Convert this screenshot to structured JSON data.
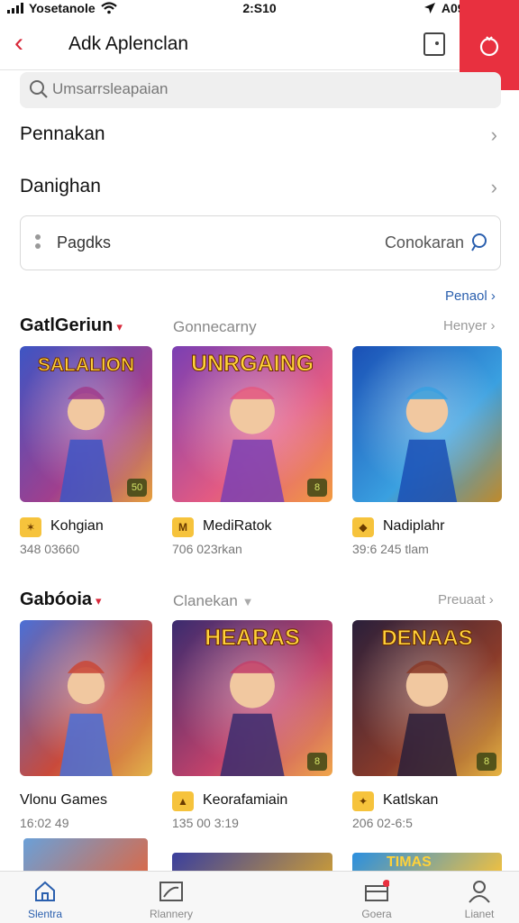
{
  "status_bar": {
    "carrier": "Yosetanole",
    "time": "2:S10",
    "battery_text": "A09%"
  },
  "header": {
    "title": "Adk Aplenclan"
  },
  "search": {
    "placeholder": "Umsarrsleapaian"
  },
  "rows": [
    {
      "label": "Pennakan"
    },
    {
      "label": "Danighan"
    }
  ],
  "filter": {
    "left_text": "Pagdks",
    "right_text": "Conokaran"
  },
  "panel_link": "Penaol",
  "sections": [
    {
      "title": "GatlGeriun",
      "middle": "Gonnecarny",
      "right": "Henyer",
      "games": [
        {
          "name": "Kohgian",
          "sub": "348 03660",
          "art_title": "SALALION",
          "corner": "50",
          "badge": "✶",
          "colors": [
            "#3d55c4",
            "#a03f8e",
            "#e6a03b"
          ]
        },
        {
          "name": "MediRatok",
          "sub": "706 023rkan",
          "art_title": "UNRGAING",
          "corner": "8",
          "badge": "M",
          "colors": [
            "#7b3fb3",
            "#e25a83",
            "#f29b3f"
          ]
        },
        {
          "name": "Nadiplahr",
          "sub": "39:6 245 tlam",
          "art_title": "",
          "corner": "",
          "badge": "◆",
          "colors": [
            "#1a4fb5",
            "#3aa0e0",
            "#c08a2a"
          ]
        }
      ]
    },
    {
      "title": "Gabóoia",
      "middle": "Clanekan",
      "right": "Preuaat",
      "games": [
        {
          "name": "Vlonu Games",
          "sub": "16:02 49",
          "art_title": "",
          "corner": "",
          "badge": "",
          "colors": [
            "#4a6fd6",
            "#c94a3b",
            "#e2b34a"
          ]
        },
        {
          "name": "Keorafamiain",
          "sub": "135 00 3:19",
          "art_title": "HEARAS",
          "corner": "8",
          "badge": "▲",
          "colors": [
            "#3a2b6e",
            "#c2426b",
            "#f0a64a"
          ]
        },
        {
          "name": "Katlskan",
          "sub": "206 02-6:5",
          "art_title": "DENAAS",
          "corner": "8",
          "badge": "✦",
          "colors": [
            "#2a1f3a",
            "#8a3b2a",
            "#e6b442"
          ]
        }
      ]
    }
  ],
  "bottom_row_titles": [
    "",
    "",
    "TIMAS"
  ],
  "tabs": [
    {
      "label": "Slentra",
      "icon": "home-icon"
    },
    {
      "label": "Rlannery",
      "icon": "chart-icon"
    },
    {
      "label": "Goera",
      "icon": "cart-icon"
    },
    {
      "label": "Lianet",
      "icon": "person-icon"
    }
  ],
  "colors": {
    "accent_red": "#e8303f",
    "link_blue": "#2a5fae"
  }
}
